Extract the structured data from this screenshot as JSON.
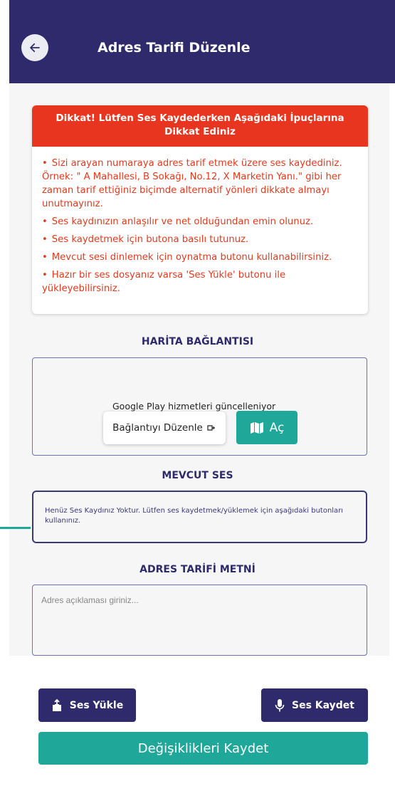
{
  "appbar": {
    "title": "Adres Tarifi Düzenle",
    "back_icon": "arrow-left-icon",
    "color": "#2e2a6b"
  },
  "tips": {
    "header": "Dikkat! Lütfen Ses Kaydederken Aşağıdaki İpuçlarına Dikkat Ediniz",
    "items": [
      "Sizi arayan numaraya adres tarif etmek üzere ses kaydediniz. Örnek: \" A Mahallesi, B Sokağı, No.12, X Marketin Yanı.\" gibi her zaman tarif ettiğiniz biçimde alternatif yönleri dikkate almayı unutmayınız.",
      "Ses kaydınızın anlaşılır ve net olduğundan emin olunuz.",
      "Ses kaydetmek için butona basılı tutunuz.",
      "Mevcut sesi dinlemek için oynatma butonu kullanabilirsiniz.",
      "Hazır bir ses dosyanız varsa 'Ses Yükle' butonu ile yükleyebilirsiniz."
    ],
    "header_color": "#e8351f"
  },
  "map_section": {
    "title": "HARİTA BAĞLANTISI",
    "status": "Google Play hizmetleri güncelleniyor",
    "edit_label": "Bağlantıyı Düzenle",
    "open_label": "Aç"
  },
  "audio_section": {
    "title": "MEVCUT SES",
    "message": "Henüz Ses Kaydınız Yoktur. Lütfen ses kaydetmek/yüklemek için aşağıdaki butonları kullanınız."
  },
  "description_section": {
    "title": "ADRES TARİFİ METNİ",
    "placeholder": "Adres açıklaması giriniz...",
    "value": ""
  },
  "actions": {
    "upload_label": "Ses Yükle",
    "record_label": "Ses Kaydet",
    "save_label": "Değişiklikleri Kaydet",
    "save_color": "#1fa89a"
  }
}
